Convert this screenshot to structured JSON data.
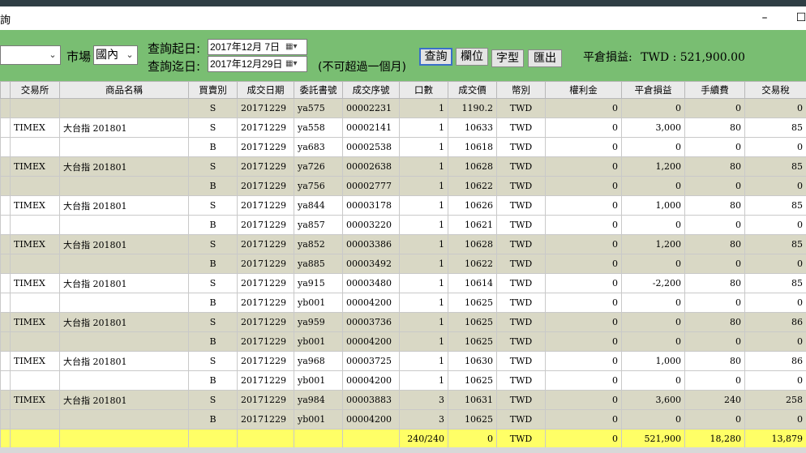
{
  "window": {
    "title": "詢",
    "min_glyph": "–",
    "max_glyph": "☐"
  },
  "toolbar": {
    "account_value": "",
    "market_label": "市場",
    "market_value": "國內",
    "start_label": "查詢起日:",
    "end_label": "查詢迄日:",
    "start_date": "2017年12月 7日",
    "end_date": "2017年12月29日",
    "note": "(不可超過一個月)",
    "btn_query": "查詢",
    "btn_columns": "欄位",
    "btn_font": "字型",
    "btn_export": "匯出",
    "pl_label": "平倉損益:",
    "pl_value": "TWD : 521,900.00"
  },
  "columns": [
    "交易所",
    "商品名稱",
    "買賣別",
    "成交日期",
    "委託書號",
    "成交序號",
    "口數",
    "成交價",
    "幣別",
    "權利金",
    "平倉損益",
    "手續費",
    "交易稅"
  ],
  "rows": [
    [
      "",
      "",
      "S",
      "20171229",
      "ya575",
      "00002231",
      "1",
      "1190.2",
      "TWD",
      "0",
      "0",
      "0",
      "0"
    ],
    [
      "TIMEX",
      "大台指 201801",
      "S",
      "20171229",
      "ya558",
      "00002141",
      "1",
      "10633",
      "TWD",
      "0",
      "3,000",
      "80",
      "85"
    ],
    [
      "",
      "",
      "B",
      "20171229",
      "ya683",
      "00002538",
      "1",
      "10618",
      "TWD",
      "0",
      "0",
      "0",
      "0"
    ],
    [
      "TIMEX",
      "大台指 201801",
      "S",
      "20171229",
      "ya726",
      "00002638",
      "1",
      "10628",
      "TWD",
      "0",
      "1,200",
      "80",
      "85"
    ],
    [
      "",
      "",
      "B",
      "20171229",
      "ya756",
      "00002777",
      "1",
      "10622",
      "TWD",
      "0",
      "0",
      "0",
      "0"
    ],
    [
      "TIMEX",
      "大台指 201801",
      "S",
      "20171229",
      "ya844",
      "00003178",
      "1",
      "10626",
      "TWD",
      "0",
      "1,000",
      "80",
      "85"
    ],
    [
      "",
      "",
      "B",
      "20171229",
      "ya857",
      "00003220",
      "1",
      "10621",
      "TWD",
      "0",
      "0",
      "0",
      "0"
    ],
    [
      "TIMEX",
      "大台指 201801",
      "S",
      "20171229",
      "ya852",
      "00003386",
      "1",
      "10628",
      "TWD",
      "0",
      "1,200",
      "80",
      "85"
    ],
    [
      "",
      "",
      "B",
      "20171229",
      "ya885",
      "00003492",
      "1",
      "10622",
      "TWD",
      "0",
      "0",
      "0",
      "0"
    ],
    [
      "TIMEX",
      "大台指 201801",
      "S",
      "20171229",
      "ya915",
      "00003480",
      "1",
      "10614",
      "TWD",
      "0",
      "-2,200",
      "80",
      "85"
    ],
    [
      "",
      "",
      "B",
      "20171229",
      "yb001",
      "00004200",
      "1",
      "10625",
      "TWD",
      "0",
      "0",
      "0",
      "0"
    ],
    [
      "TIMEX",
      "大台指 201801",
      "S",
      "20171229",
      "ya959",
      "00003736",
      "1",
      "10625",
      "TWD",
      "0",
      "0",
      "80",
      "86"
    ],
    [
      "",
      "",
      "B",
      "20171229",
      "yb001",
      "00004200",
      "1",
      "10625",
      "TWD",
      "0",
      "0",
      "0",
      "0"
    ],
    [
      "TIMEX",
      "大台指 201801",
      "S",
      "20171229",
      "ya968",
      "00003725",
      "1",
      "10630",
      "TWD",
      "0",
      "1,000",
      "80",
      "86"
    ],
    [
      "",
      "",
      "B",
      "20171229",
      "yb001",
      "00004200",
      "1",
      "10625",
      "TWD",
      "0",
      "0",
      "0",
      "0"
    ],
    [
      "TIMEX",
      "大台指 201801",
      "S",
      "20171229",
      "ya984",
      "00003883",
      "3",
      "10631",
      "TWD",
      "0",
      "3,600",
      "240",
      "258"
    ],
    [
      "",
      "",
      "B",
      "20171229",
      "yb001",
      "00004200",
      "3",
      "10625",
      "TWD",
      "0",
      "0",
      "0",
      "0"
    ]
  ],
  "totals": [
    "",
    "",
    "",
    "",
    "",
    "",
    "240/240",
    "0",
    "TWD",
    "0",
    "521,900",
    "18,280",
    "13,879"
  ],
  "colors": {
    "toolbar_bg": "#79be72",
    "alt_row": "#d9d8c5",
    "total_row": "#ffff66"
  }
}
